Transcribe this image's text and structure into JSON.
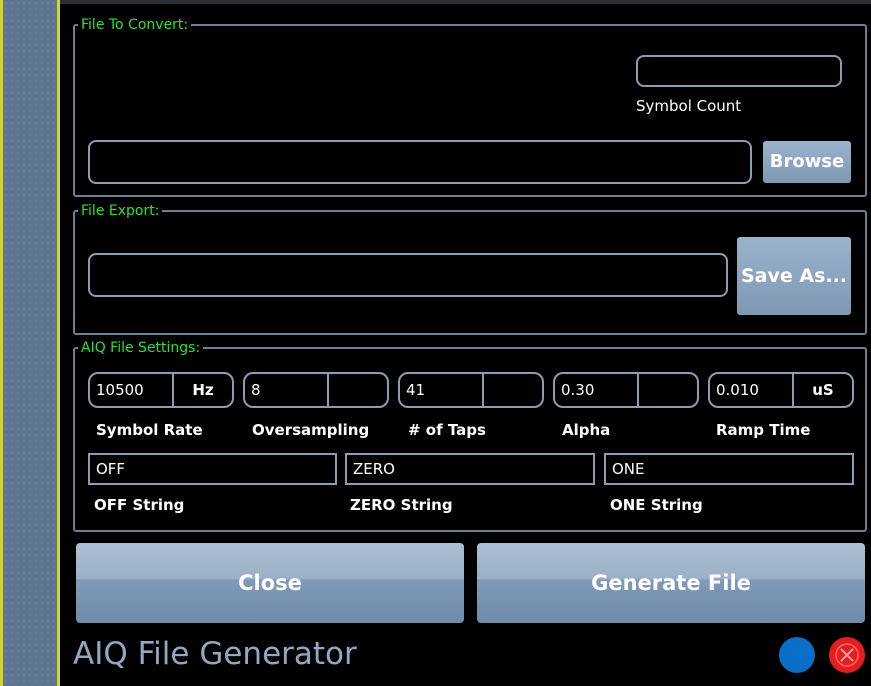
{
  "file_to_convert": {
    "legend": "File To Convert:",
    "symbol_count_label": "Symbol Count",
    "symbol_count_value": "",
    "path_value": "",
    "browse_label": "Browse"
  },
  "file_export": {
    "legend": "File Export:",
    "path_value": "",
    "save_as_label": "Save As..."
  },
  "aiq_settings": {
    "legend": "AIQ File Settings:",
    "symbol_rate": {
      "value": "10500",
      "unit": "Hz",
      "label": "Symbol Rate"
    },
    "oversampling": {
      "value": "8",
      "unit": "",
      "label": "Oversampling"
    },
    "taps": {
      "value": "41",
      "unit": "",
      "label": "# of Taps"
    },
    "alpha": {
      "value": "0.30",
      "unit": "",
      "label": "Alpha"
    },
    "ramp_time": {
      "value": "0.010",
      "unit": "uS",
      "label": "Ramp Time"
    },
    "off_string": {
      "value": "OFF",
      "label": "OFF String"
    },
    "zero_string": {
      "value": "ZERO",
      "label": "ZERO String"
    },
    "one_string": {
      "value": "ONE",
      "label": "ONE String"
    }
  },
  "buttons": {
    "close_label": "Close",
    "generate_label": "Generate File"
  },
  "footer": {
    "title": "AIQ File Generator",
    "status_colors": {
      "blue": "#0a6fc9",
      "red": "#e41e1e"
    }
  }
}
